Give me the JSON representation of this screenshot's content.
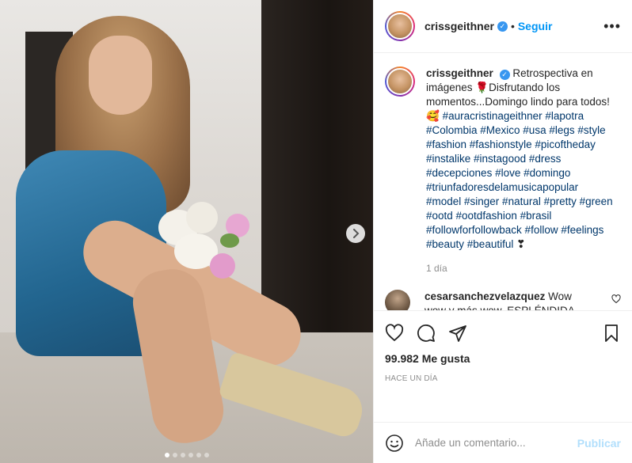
{
  "post": {
    "carousel_dots": 6,
    "active_dot": 0
  },
  "header": {
    "username": "crissgeithner",
    "separator": "•",
    "follow_label": "Seguir",
    "more_label": "•••"
  },
  "caption": {
    "username": "crissgeithner",
    "text_before": "Retrospectiva en imágenes 🌹Disfrutando los momentos...Domingo lindo para todos! 🥰",
    "hashtags": "#auracristinageithner #lapotra #Colombia #Mexico #usa #legs #style #fashion #fashionstyle #picoftheday #instalike #instagood #dress #decepciones #love #domingo #triunfadoresdelamusicapopular #model #singer #natural #pretty #green #ootd #ootdfashion #brasil #followforfollowback #follow #feelings #beauty #beautiful",
    "text_after": " ❣",
    "time": "1 día"
  },
  "comment": {
    "username": "cesarsanchezvelazquez",
    "text": "Wow wow y más wow, ESPLÉNDIDA, que belleza 😍😍😍😍😍😍"
  },
  "actions": {
    "likes": "99.982 Me gusta",
    "posted": "HACE UN DÍA"
  },
  "add_comment": {
    "placeholder": "Añade un comentario...",
    "publish_label": "Publicar"
  },
  "icons": {
    "like": "heart-icon",
    "comment": "comment-icon",
    "share": "paper-plane-icon",
    "save": "bookmark-icon",
    "emoji": "smiley-icon",
    "next": "chevron-right-icon",
    "verified": "verified-badge-icon"
  }
}
